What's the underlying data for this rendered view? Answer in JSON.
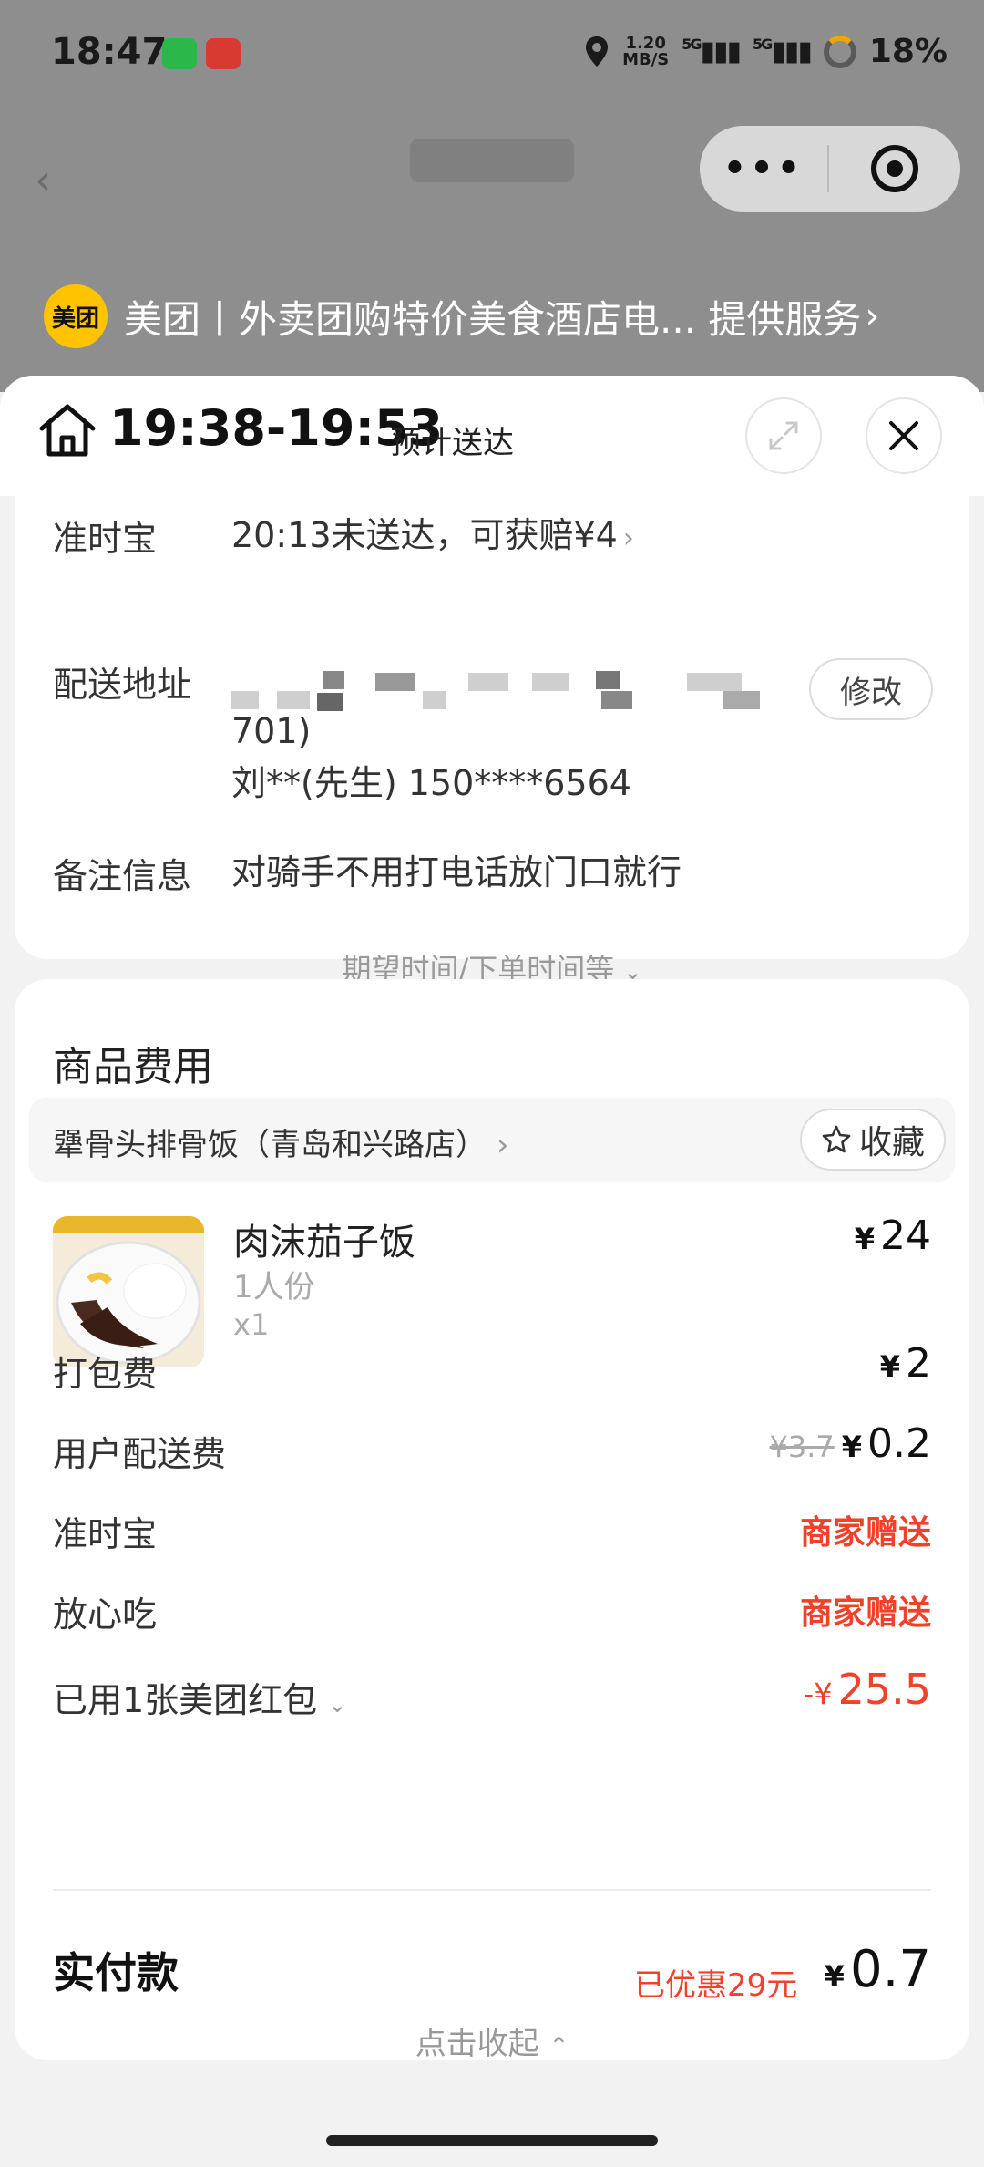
{
  "status_bar": {
    "time": "18:47",
    "speed_value": "1.20",
    "speed_unit": "MB/S",
    "signal_1": "5G",
    "signal_2": "5G",
    "battery": "18%"
  },
  "capsule": {
    "more_label": "•••"
  },
  "provider": {
    "logo_text": "美团",
    "text": "美团丨外卖团购特价美食酒店电... 提供服务",
    "chevron": "›"
  },
  "header": {
    "eta_time": "19:38-19:53",
    "eta_label": "预计送达"
  },
  "delivery": {
    "ontime_label": "准时宝",
    "ontime_value": "20:13未送达，可获赔¥4",
    "address_label": "配送地址",
    "address_line2": "701)",
    "address_contact": "刘**(先生) 150****6564",
    "modify_label": "修改",
    "remark_label": "备注信息",
    "remark_value": "对骑手不用打电话放门口就行",
    "more_link": "期望时间/下单时间等"
  },
  "fees": {
    "title": "商品费用",
    "shop_name": "犟骨头排骨饭（青岛和兴路店）",
    "fav_label": "收藏",
    "item": {
      "name": "肉沫茄子饭",
      "spec": "1人份",
      "qty": "x1",
      "currency": "¥",
      "price": "24"
    },
    "packing_label": "打包费",
    "packing_price": "2",
    "delivery_fee_label": "用户配送费",
    "delivery_fee_original": "¥3.7",
    "delivery_fee_price": "0.2",
    "ontime_label": "准时宝",
    "ontime_value": "商家赠送",
    "safe_label": "放心吃",
    "safe_value": "商家赠送",
    "coupon_label": "已用1张美团红包",
    "coupon_sign": "-¥",
    "coupon_amount": "25.5",
    "paid_label": "实付款",
    "saved_text": "已优惠29元",
    "paid_amount": "0.7",
    "collapse_label": "点击收起"
  },
  "colors": {
    "accent_red": "#f0412b",
    "brand_yellow": "#ffc300"
  }
}
